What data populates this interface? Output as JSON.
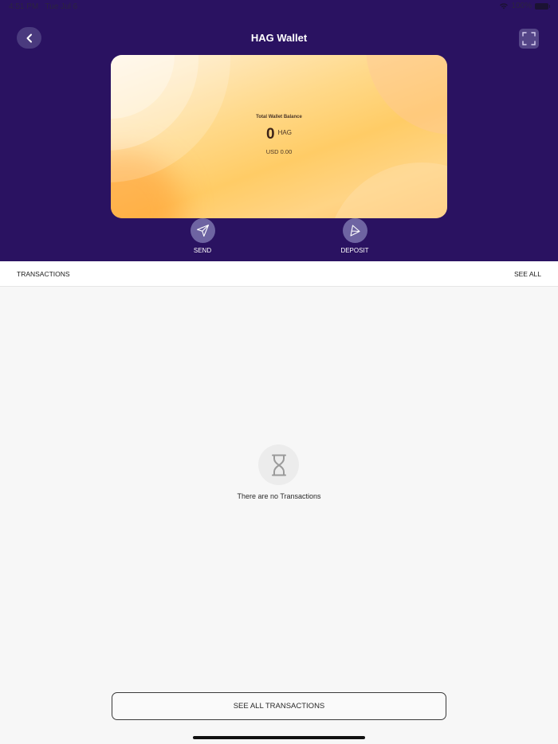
{
  "status_bar": {
    "time": "4:51 PM",
    "date": "Tue Jul 6",
    "battery": "100%"
  },
  "header": {
    "title": "HAG Wallet"
  },
  "card": {
    "balance_label": "Total Wallet Balance",
    "amount": "0",
    "currency": "HAG",
    "usd_value": "USD 0.00"
  },
  "actions": [
    {
      "label": "SEND",
      "icon": "send-icon"
    },
    {
      "label": "DEPOSIT",
      "icon": "deposit-icon"
    }
  ],
  "transactions": {
    "title": "TRANSACTIONS",
    "see_all": "SEE ALL",
    "empty_message": "There are no Transactions",
    "see_all_button": "SEE ALL TRANSACTIONS"
  },
  "colors": {
    "header_bg": "#2a1261",
    "action_circle": "#6e64a2",
    "page_bg": "#f7f7f7"
  }
}
